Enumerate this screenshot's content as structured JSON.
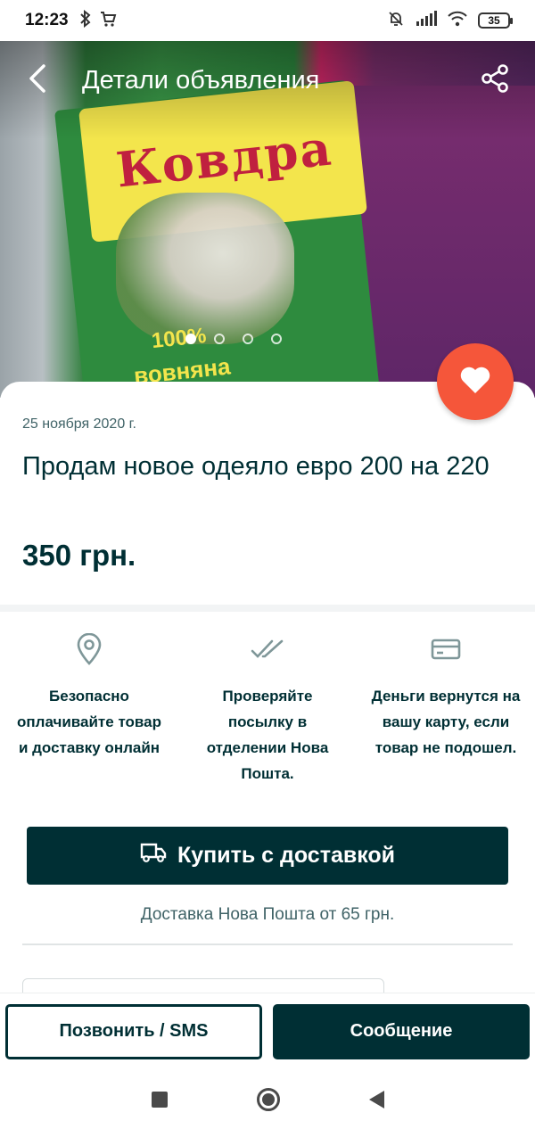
{
  "status_bar": {
    "time": "12:23",
    "battery": "35",
    "icons": [
      "bluetooth-icon",
      "cart-icon",
      "bell-off-icon",
      "signal-icon",
      "wifi-icon",
      "battery-icon"
    ]
  },
  "header": {
    "title": "Детали объявления",
    "back_icon": "chevron-left-icon",
    "share_icon": "share-icon"
  },
  "gallery": {
    "image_count": 4,
    "active_index": 0,
    "image_text": {
      "brand": "Ковдра",
      "percent": "100%",
      "material": "вовняна"
    }
  },
  "listing": {
    "date": "25 ноября 2020 г.",
    "title": "Продам новое одеяло евро 200 на 220",
    "price": "350 грн.",
    "favorite_icon": "heart-icon"
  },
  "features": [
    {
      "icon": "location-pin-icon",
      "text": "Безопасно оплачивайте товар и доставку онлайн"
    },
    {
      "icon": "double-check-icon",
      "text": "Проверяйте посылку в отделении Нова Пошта."
    },
    {
      "icon": "card-icon",
      "text": "Деньги вернутся на вашу карту, если товар не подошел."
    }
  ],
  "buy": {
    "label": "Купить с доставкой",
    "icon": "truck-icon",
    "delivery_note": "Доставка Нова Пошта от 65 грн."
  },
  "actions": {
    "call_label": "Позвонить / SMS",
    "message_label": "Сообщение"
  },
  "colors": {
    "primary": "#002f34",
    "accent": "#f5563a",
    "muted": "#406367"
  }
}
